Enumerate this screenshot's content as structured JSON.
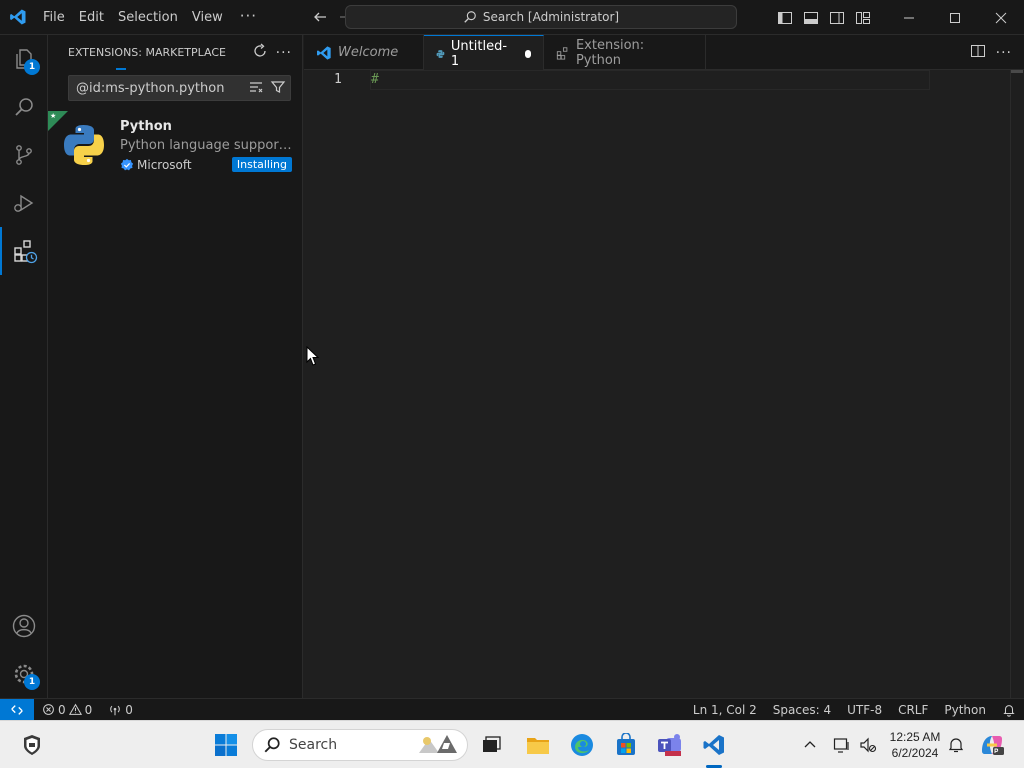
{
  "titlebar": {
    "menu": [
      "File",
      "Edit",
      "Selection",
      "View"
    ],
    "more": "···",
    "command_center": "Search [Administrator]"
  },
  "activitybar": {
    "explorer_badge": "1",
    "settings_badge": "1"
  },
  "sidebar": {
    "title": "EXTENSIONS: MARKETPLACE",
    "search_value": "@id:ms-python.python",
    "extension": {
      "name": "Python",
      "description": "Python language support wi...",
      "publisher": "Microsoft",
      "status": "Installing"
    }
  },
  "tabs": [
    {
      "label": "Welcome"
    },
    {
      "label": "Untitled-1"
    },
    {
      "label": "Extension: Python"
    }
  ],
  "editor": {
    "line_number": "1",
    "line_text": "#"
  },
  "statusbar": {
    "errors": "0",
    "warnings": "0",
    "ports": "0",
    "position": "Ln 1, Col 2",
    "spaces": "Spaces: 4",
    "encoding": "UTF-8",
    "eol": "CRLF",
    "language": "Python"
  },
  "taskbar": {
    "search_label": "Search",
    "time": "12:25 AM",
    "date": "6/2/2024"
  },
  "colors": {
    "accent": "#0078d4",
    "background": "#1f1f1f",
    "chrome": "#181818"
  }
}
